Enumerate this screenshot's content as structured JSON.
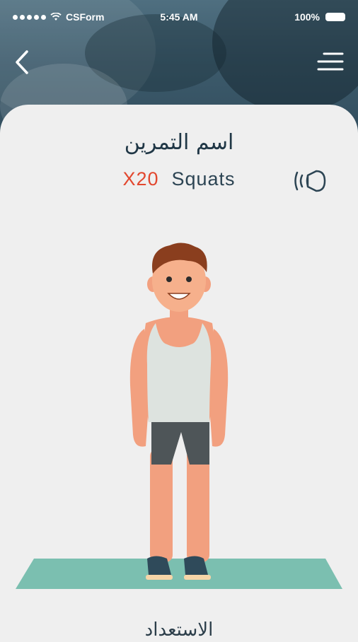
{
  "status_bar": {
    "carrier": "CSForm",
    "time": "5:45 AM",
    "battery": "100%"
  },
  "header": {
    "back_icon": "chevron-left-icon",
    "menu_icon": "hamburger-menu-icon"
  },
  "exercise": {
    "title": "اسم التمرين",
    "reps": "X20",
    "name": "Squats",
    "sound_icon": "speaker-icon"
  },
  "footer": {
    "label": "الاستعداد"
  },
  "colors": {
    "reps": "#e2482f",
    "text_dark": "#203746",
    "mat": "#7bbfb0",
    "background": "#efefef"
  }
}
